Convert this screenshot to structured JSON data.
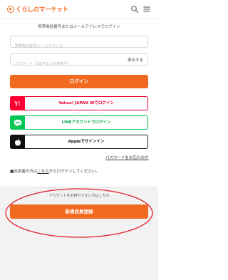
{
  "header": {
    "logo_text": "くらしのマーケット",
    "icons": [
      "search-icon",
      "menu-icon"
    ]
  },
  "login": {
    "prompt": "携帯電話番号またはメールアドレスでログイン",
    "username_placeholder": "携帯電話番号/メールアドレス",
    "password_placeholder": "パスワード（8文字以上の英数字）",
    "show_label": "表示する",
    "login_button": "ログイン"
  },
  "sns": {
    "yahoo_label": "Yahoo! JAPAN IDでログイン",
    "yahoo_icon_text": "Y!",
    "line_label": "LINEアカウントでログイン",
    "apple_label": "Appleでサインイン"
  },
  "links": {
    "forgot_password": "パスワードをお忘れの方",
    "store_note_prefix": "■出店者の方は",
    "store_note_link": "こちら",
    "store_note_suffix": "からログインしてください。"
  },
  "register": {
    "no_account_text": "アカウントをお持ちでない方はこちら",
    "register_button": "新規会員登録"
  },
  "colors": {
    "brand": "#f26a20",
    "yahoo": "#ff0033",
    "line": "#06c755",
    "apple": "#111111",
    "highlight": "#e0202a"
  }
}
